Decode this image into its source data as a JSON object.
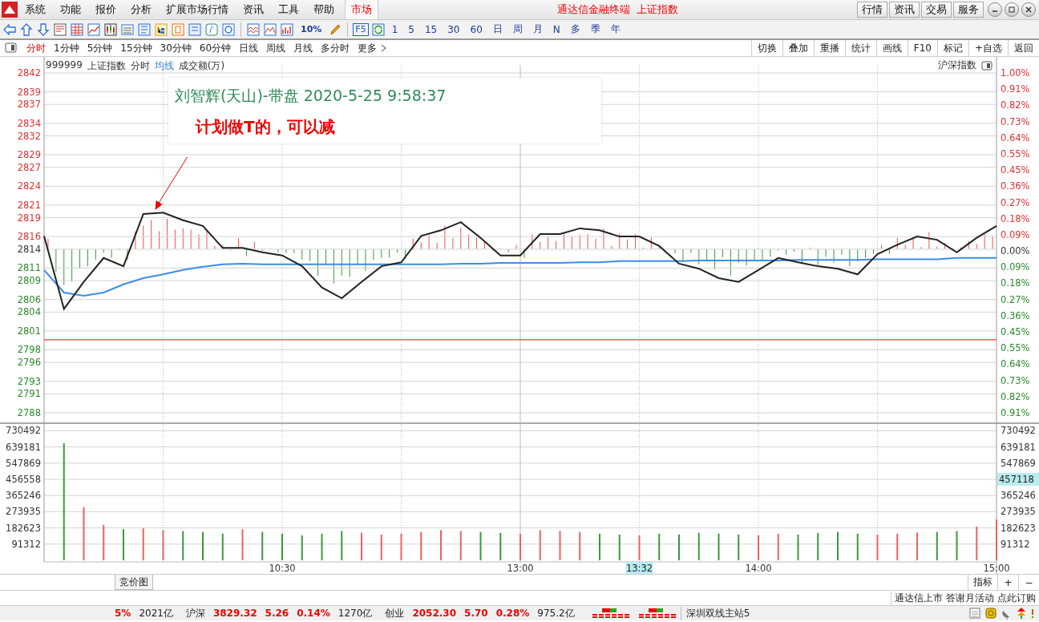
{
  "window": {
    "title": "通达信金融终端  上证指数",
    "buttons": [
      "行情",
      "资讯",
      "交易",
      "服务"
    ]
  },
  "menu": [
    "系统",
    "功能",
    "报价",
    "分析",
    "扩展市场行情",
    "资讯",
    "工具",
    "帮助"
  ],
  "market_tab": {
    "label": "市场",
    "selected": true
  },
  "toolbar": {
    "zoom_label": "10%",
    "f5_label": "F5",
    "periods": [
      "1",
      "5",
      "15",
      "30",
      "60",
      "日",
      "周",
      "月",
      "N",
      "多",
      "季",
      "年"
    ]
  },
  "period_tabs": [
    {
      "label": "分时",
      "selected": true
    },
    {
      "label": "1分钟",
      "selected": false
    },
    {
      "label": "5分钟",
      "selected": false
    },
    {
      "label": "15分钟",
      "selected": false
    },
    {
      "label": "30分钟",
      "selected": false
    },
    {
      "label": "60分钟",
      "selected": false
    },
    {
      "label": "日线",
      "selected": false
    },
    {
      "label": "周线",
      "selected": false
    },
    {
      "label": "月线",
      "selected": false
    },
    {
      "label": "多分时",
      "selected": false
    },
    {
      "label": "更多",
      "selected": false
    }
  ],
  "chart_tools": [
    "切换",
    "叠加",
    "重播",
    "统计",
    "画线",
    "F10",
    "标记",
    "+自选",
    "返回"
  ],
  "chart_header": {
    "code": "999999",
    "name": "上证指数",
    "index_label": "沪深指数"
  },
  "annotation": {
    "author": "刘智辉(天山)-带盘 2020-5-25 9:58:37",
    "note": "计划做T的，可以减"
  },
  "price_chart": {
    "chart_data": {
      "type": "line",
      "categories": [
        null,
        null,
        null,
        null,
        null,
        null,
        null,
        null,
        null,
        null,
        null,
        null,
        null,
        null,
        null,
        null,
        null,
        null,
        null,
        null,
        null,
        null,
        null,
        null,
        null,
        null,
        null,
        null,
        null,
        null,
        null,
        null,
        null,
        null,
        null,
        null,
        null,
        null,
        null,
        null,
        null,
        null,
        null,
        null,
        null,
        null,
        null,
        null,
        null
      ],
      "series": [
        {
          "name": "分时",
          "color": "#222222",
          "values": [
            2816.1,
            2804.5,
            2808.8,
            2812.6,
            2811.3,
            2819.6,
            2819.8,
            2818.6,
            2817.7,
            2814.2,
            2814.2,
            2813.5,
            2813.0,
            2811.3,
            2807.9,
            2806.2,
            2808.8,
            2811.3,
            2811.9,
            2816.1,
            2817.0,
            2818.3,
            2815.8,
            2813.0,
            2813.0,
            2816.4,
            2816.4,
            2817.3,
            2817.0,
            2816.0,
            2816.0,
            2814.5,
            2811.7,
            2810.9,
            2809.4,
            2808.8,
            2810.7,
            2812.6,
            2811.9,
            2811.3,
            2810.9,
            2810.0,
            2813.2,
            2814.7,
            2816.0,
            2815.5,
            2813.5,
            2815.8,
            2817.7
          ]
        },
        {
          "name": "均线",
          "color": "#3a8ee6",
          "values": [
            2810.7,
            2807.1,
            2806.6,
            2807.1,
            2808.4,
            2809.4,
            2810.0,
            2810.7,
            2811.2,
            2811.6,
            2811.7,
            2811.6,
            2811.6,
            2811.6,
            2811.6,
            2811.6,
            2811.6,
            2811.6,
            2811.6,
            2811.6,
            2811.6,
            2811.7,
            2811.7,
            2811.8,
            2811.8,
            2811.8,
            2811.8,
            2811.9,
            2811.9,
            2812.1,
            2812.1,
            2812.1,
            2812.1,
            2812.2,
            2812.2,
            2812.2,
            2812.2,
            2812.2,
            2812.3,
            2812.3,
            2812.3,
            2812.3,
            2812.4,
            2812.4,
            2812.4,
            2812.4,
            2812.6,
            2812.6,
            2812.6
          ]
        }
      ],
      "ylim": [
        2788,
        2842
      ],
      "yticks": [
        2842,
        2839,
        2837,
        2834,
        2832,
        2829,
        2827,
        2824,
        2821,
        2819,
        2816,
        2814,
        2811,
        2809,
        2806,
        2804,
        2801,
        2798,
        2796,
        2793,
        2791,
        2788
      ],
      "grid": true,
      "ref_lines": [
        {
          "axis": "y",
          "value": 2799.6
        }
      ]
    }
  },
  "percent_axis": [
    {
      "label": "1.00%",
      "kind": "up"
    },
    {
      "label": "0.91%",
      "kind": "up"
    },
    {
      "label": "0.82%",
      "kind": "up"
    },
    {
      "label": "0.73%",
      "kind": "up"
    },
    {
      "label": "0.64%",
      "kind": "up"
    },
    {
      "label": "0.55%",
      "kind": "up"
    },
    {
      "label": "0.45%",
      "kind": "up"
    },
    {
      "label": "0.36%",
      "kind": "up"
    },
    {
      "label": "0.27%",
      "kind": "up"
    },
    {
      "label": "0.18%",
      "kind": "up"
    },
    {
      "label": "0.09%",
      "kind": "up"
    },
    {
      "label": "0.00%",
      "kind": "flat"
    },
    {
      "label": "0.09%",
      "kind": "down"
    },
    {
      "label": "0.18%",
      "kind": "down"
    },
    {
      "label": "0.27%",
      "kind": "down"
    },
    {
      "label": "0.36%",
      "kind": "down"
    },
    {
      "label": "0.45%",
      "kind": "down"
    },
    {
      "label": "0.55%",
      "kind": "down"
    },
    {
      "label": "0.64%",
      "kind": "down"
    },
    {
      "label": "0.73%",
      "kind": "down"
    },
    {
      "label": "0.82%",
      "kind": "down"
    },
    {
      "label": "0.91%",
      "kind": "down"
    }
  ],
  "volume_chart": {
    "chart_data": {
      "type": "bar",
      "categories": [
        null,
        null,
        null,
        null,
        null,
        null,
        null,
        null,
        null,
        null,
        null,
        "10:30",
        null,
        null,
        null,
        null,
        null,
        null,
        null,
        null,
        null,
        null,
        null,
        "13:00",
        null,
        null,
        null,
        null,
        null,
        null,
        null,
        null,
        null,
        null,
        null,
        "14:00",
        null,
        null,
        null,
        null,
        null,
        null,
        null,
        null,
        null,
        null,
        null,
        "15:00"
      ],
      "series": [
        {
          "name": "成交额(万)",
          "values": [
            660000,
            300000,
            200000,
            175000,
            180000,
            170000,
            165000,
            160000,
            150000,
            175000,
            160000,
            150000,
            140000,
            150000,
            165000,
            155000,
            145000,
            150000,
            160000,
            170000,
            165000,
            160000,
            155000,
            150000,
            170000,
            165000,
            160000,
            150000,
            145000,
            140000,
            150000,
            145000,
            155000,
            150000,
            145000,
            140000,
            150000,
            145000,
            155000,
            160000,
            150000,
            145000,
            150000,
            155000,
            160000,
            165000,
            190000,
            230000
          ]
        }
      ],
      "ylim": [
        0,
        730492
      ],
      "grid": true,
      "yticks": [
        730492,
        639181,
        547869,
        456558,
        365246,
        273935,
        182623,
        91312
      ]
    },
    "right_ticks": [
      "730492",
      "639181",
      "547869",
      "365246",
      "273935",
      "182623",
      "91312"
    ],
    "cursor_value": "457118",
    "cursor_time": "13:32"
  },
  "bottom_tabs": [
    "竞价图"
  ],
  "indicator_buttons": [
    "指标",
    "+",
    "−"
  ],
  "promo": "通达信上市 答谢月活动 点此订购",
  "status_bar": {
    "items": [
      {
        "text": "5%",
        "kind": "value"
      },
      {
        "text": "2021亿",
        "kind": "plain"
      },
      {
        "text": "沪深",
        "kind": "label"
      },
      {
        "text": "3829.32",
        "kind": "value"
      },
      {
        "text": "5.26",
        "kind": "value"
      },
      {
        "text": "0.14%",
        "kind": "value"
      },
      {
        "text": "1270亿",
        "kind": "plain"
      },
      {
        "text": "创业",
        "kind": "label"
      },
      {
        "text": "2052.30",
        "kind": "value"
      },
      {
        "text": "5.70",
        "kind": "value"
      },
      {
        "text": "0.28%",
        "kind": "value"
      },
      {
        "text": "975.2亿",
        "kind": "plain"
      }
    ],
    "server": "深圳双线主站5"
  }
}
